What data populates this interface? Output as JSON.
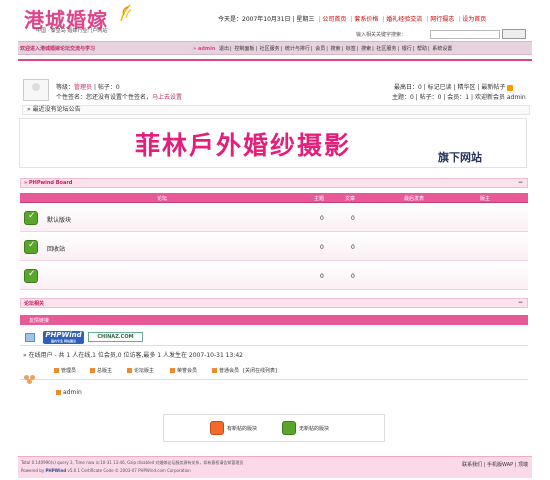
{
  "header": {
    "logo_text": "港城婚嫁",
    "logo_sub": "中国 · 秦皇岛  婚嫁行业门户网站",
    "today": "今天是：2007年10月31日 | 星期三",
    "links": [
      "公司首页",
      "套系价格",
      "婚礼经验交流",
      "网行摄志",
      "设为首页"
    ],
    "search_label": "输入相关关键字搜索：",
    "search_value": "",
    "search_button": ""
  },
  "nav": {
    "welcome": "欢迎进入港城婚嫁论坛交流与学习",
    "user": "» admin",
    "items": [
      "退出",
      "控制面板",
      "社区服务",
      "统计与排行",
      "会员",
      "搜索",
      "标签",
      "搜索",
      "社区服务",
      "银行",
      "帮助",
      "系统设置"
    ]
  },
  "user": {
    "level_label": "等级：",
    "level_value": "管理员",
    "posts": "帖子：0",
    "sig_label": "个性签名：您还没有设置个性签名，",
    "sig_link": "马上去设置",
    "right1": "最高日：0 | 标记已读 | 精华区 | 最新帖子",
    "right2": "主题：0 | 帖子：0 | 会员：1 | 欢迎新会员 admin"
  },
  "no_post": "最近没有论坛公告",
  "banner": {
    "main": "菲林戶外婚纱摄影",
    "sub": "旗下网站"
  },
  "board": {
    "title": "» PHPwind Board",
    "collapse": "−",
    "columns": [
      "论坛",
      "主题",
      "文章",
      "最后发表",
      "版主"
    ],
    "rows": [
      {
        "name": "默认版块",
        "topics": "0",
        "posts": "0"
      },
      {
        "name": "回收站",
        "topics": "0",
        "posts": "0"
      },
      {
        "name": "",
        "topics": "0",
        "posts": "0"
      }
    ]
  },
  "related": {
    "title": "论坛相关",
    "collapse": "−",
    "friend_links": "友情链接",
    "logo1": "PHPWind",
    "logo1_sub": "国内专业 网站建设",
    "logo2": "CHINAZ.COM",
    "online": "» 在线用户 - 共 1 人在线,1 位会员,0 位访客,最多 1 人发生在 2007-10-31 13:42",
    "legend": [
      "管理员",
      "总版主",
      "论坛版主",
      "荣誉会员",
      "普通会员",
      "[关闭在线列表]"
    ],
    "admin": "admin"
  },
  "keys": {
    "new": "有新帖的版块",
    "old": "无新帖的版块"
  },
  "footer": {
    "line1": "Total 0.140990(s) query 3, Time now is:10-31 13:46, Gzip disabled  对婚嫁论坛服务源有关系，如有意权请告知管理员",
    "line2_a": "Powered by ",
    "line2_b": "PHPWind",
    "line2_c": " v5.0.1 Certificate Code © 2003-07 PHPWind.com Corporation",
    "right": "联系我们 | 手机版WAP | 顶端"
  }
}
